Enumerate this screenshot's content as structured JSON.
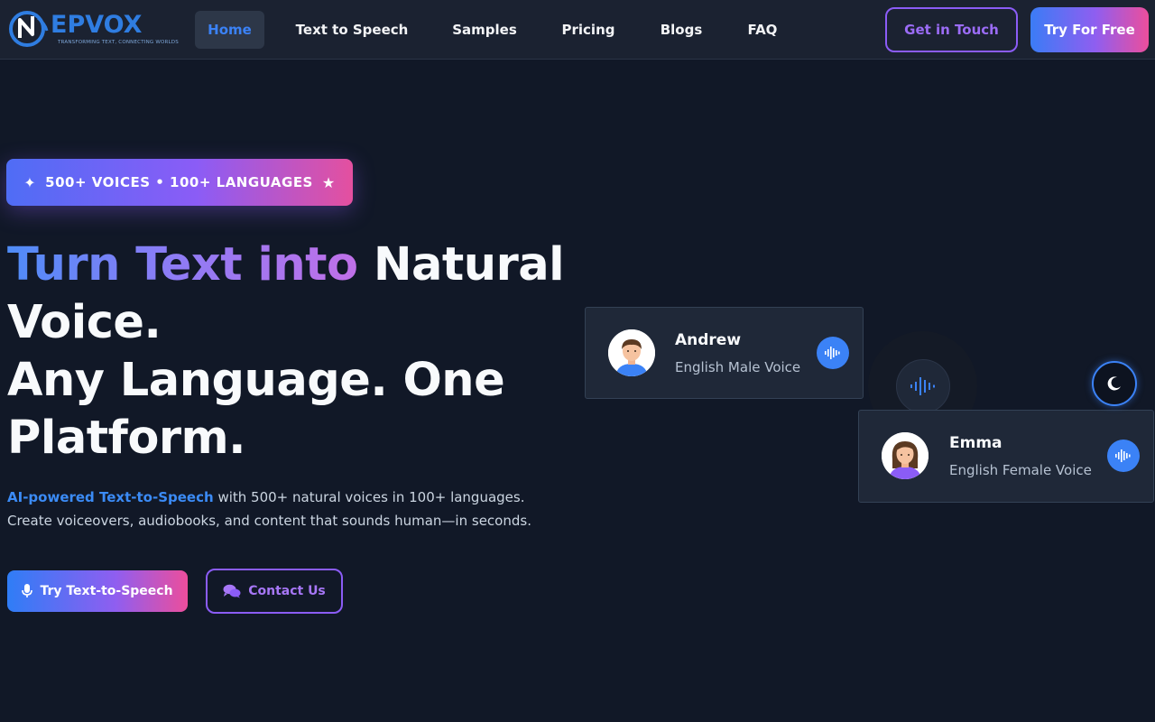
{
  "brand": {
    "name": "EPVOX",
    "tagline": "TRANSFORMING TEXT, CONNECTING WORLDS",
    "color": "#2f7de1"
  },
  "nav": {
    "items": [
      {
        "label": "Home",
        "active": true
      },
      {
        "label": "Text to Speech",
        "active": false
      },
      {
        "label": "Samples",
        "active": false
      },
      {
        "label": "Pricing",
        "active": false
      },
      {
        "label": "Blogs",
        "active": false
      },
      {
        "label": "FAQ",
        "active": false
      }
    ],
    "contact_label": "Get in Touch",
    "cta_label": "Try For Free"
  },
  "hero": {
    "badge": "500+ VOICES • 100+ LANGUAGES",
    "badge_icon": "star-icon",
    "headline_gradient": "Turn Text into",
    "headline_plain_1": " Natural Voice.",
    "headline_plain_2": "Any Language. One Platform.",
    "sub_highlight": "AI-powered Text-to-Speech",
    "sub_rest_1": " with 500+ natural voices in 100+ languages.",
    "sub_line_2": "Create voiceovers, audiobooks, and content that sounds human—in seconds.",
    "primary_button": "Try Text-to-Speech",
    "primary_icon": "microphone-icon",
    "secondary_button": "Contact Us",
    "secondary_icon": "chat-bubbles-icon"
  },
  "voices": [
    {
      "name": "Andrew",
      "description": "English Male Voice",
      "icon": "sound-wave-icon"
    },
    {
      "name": "Emma",
      "description": "English Female Voice",
      "icon": "sound-wave-icon"
    }
  ],
  "theme_toggle_icon": "moon-icon",
  "colors": {
    "background": "#111827",
    "nav_bg": "#1b2231",
    "accent_blue": "#3b82f6",
    "accent_purple": "#8b5cf6",
    "accent_pink": "#ec4e9c"
  }
}
